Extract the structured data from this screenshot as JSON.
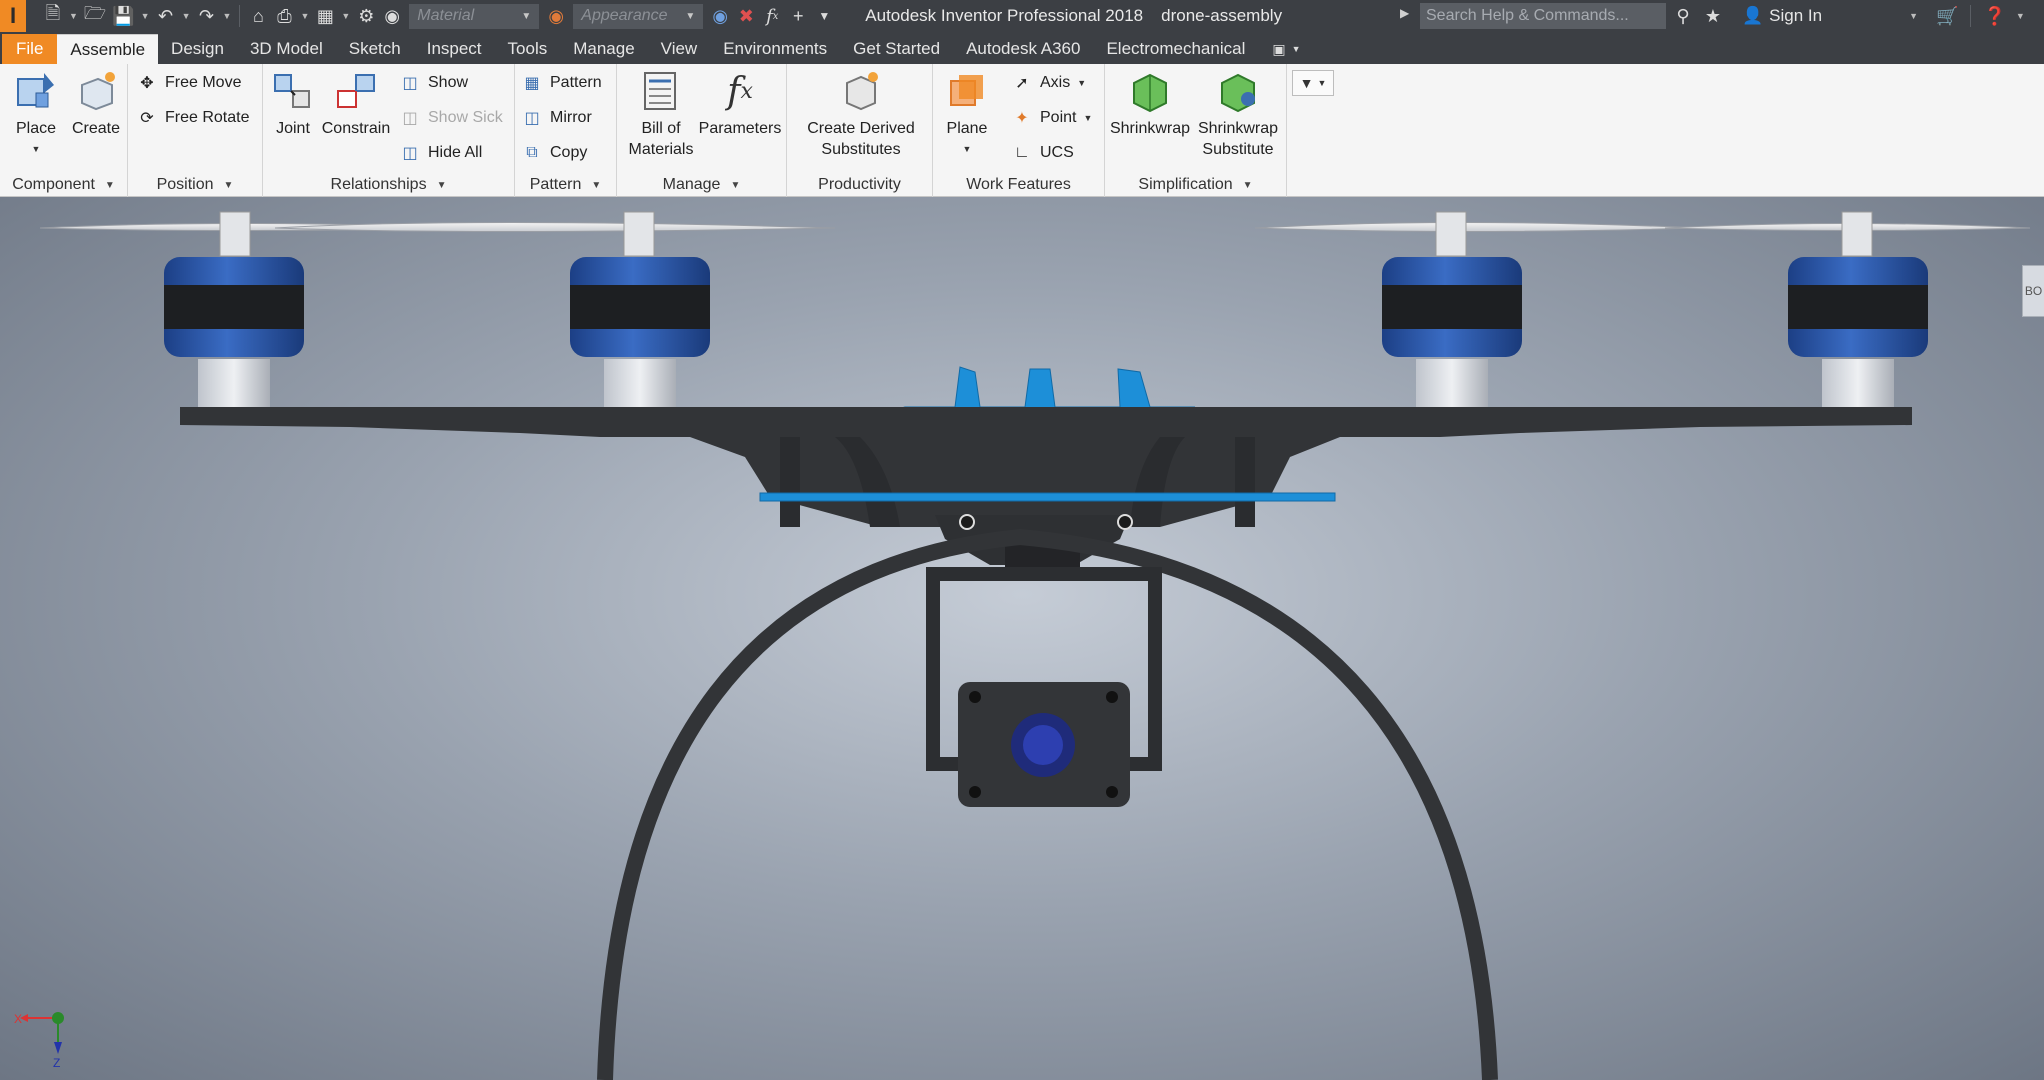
{
  "quick_access": {
    "logo": "I",
    "material_placeholder": "Material",
    "appearance_placeholder": "Appearance"
  },
  "title": {
    "app": "Autodesk Inventor Professional 2018",
    "document": "drone-assembly"
  },
  "search": {
    "placeholder": "Search Help & Commands..."
  },
  "account": {
    "sign_in": "Sign In"
  },
  "tabs": [
    {
      "label": "File"
    },
    {
      "label": "Assemble"
    },
    {
      "label": "Design"
    },
    {
      "label": "3D Model"
    },
    {
      "label": "Sketch"
    },
    {
      "label": "Inspect"
    },
    {
      "label": "Tools"
    },
    {
      "label": "Manage"
    },
    {
      "label": "View"
    },
    {
      "label": "Environments"
    },
    {
      "label": "Get Started"
    },
    {
      "label": "Autodesk A360"
    },
    {
      "label": "Electromechanical"
    }
  ],
  "ribbon": {
    "component": {
      "title": "Component",
      "place": "Place",
      "create": "Create"
    },
    "position": {
      "title": "Position",
      "free_move": "Free Move",
      "free_rotate": "Free Rotate"
    },
    "relationships": {
      "title": "Relationships",
      "joint": "Joint",
      "constrain": "Constrain",
      "show": "Show",
      "show_sick": "Show Sick",
      "hide_all": "Hide All"
    },
    "pattern": {
      "title": "Pattern",
      "pattern": "Pattern",
      "mirror": "Mirror",
      "copy": "Copy"
    },
    "manage": {
      "title": "Manage",
      "bom_line1": "Bill of",
      "bom_line2": "Materials",
      "parameters": "Parameters"
    },
    "productivity": {
      "title": "Productivity",
      "cds_line1": "Create Derived",
      "cds_line2": "Substitutes"
    },
    "work_features": {
      "title": "Work Features",
      "plane": "Plane",
      "axis": "Axis",
      "point": "Point",
      "ucs": "UCS"
    },
    "simplification": {
      "title": "Simplification",
      "shrinkwrap": "Shrinkwrap",
      "sws_line1": "Shrinkwrap",
      "sws_line2": "Substitute"
    }
  },
  "viewport": {
    "viewcube_label": "BO",
    "triad": {
      "x": "X",
      "z": "Z"
    }
  },
  "colors": {
    "accent_orange": "#f08a24",
    "motor_blue": "#2a56a8",
    "mount_blue": "#1a8fd6",
    "frame_black": "#2f3133"
  }
}
